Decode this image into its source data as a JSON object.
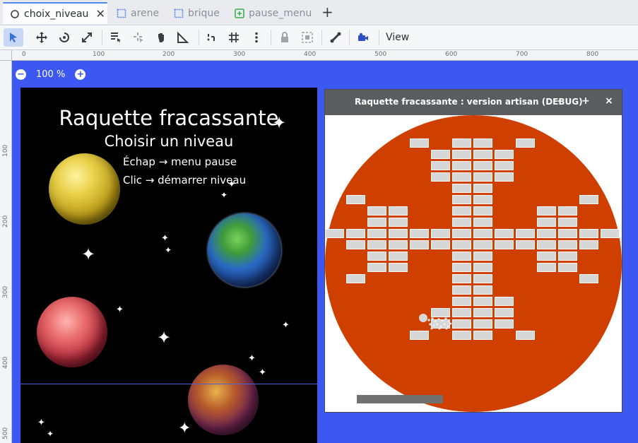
{
  "tabs": [
    {
      "label": "choix_niveau",
      "icon": "scene-node-icon",
      "active": true
    },
    {
      "label": "arene",
      "icon": "control-node-icon",
      "active": false
    },
    {
      "label": "brique",
      "icon": "control-node-icon",
      "active": false
    },
    {
      "label": "pause_menu",
      "icon": "container-node-icon",
      "active": false
    }
  ],
  "toolbar": {
    "view_label": "View",
    "tools": [
      "select-icon",
      "move-icon",
      "rotate-icon",
      "scale-icon",
      "list-select-icon",
      "pivot-icon",
      "pan-icon",
      "ruler-icon",
      "smart-snap-icon",
      "grid-snap-icon",
      "more-icon",
      "lock-icon",
      "group-icon",
      "bone-icon",
      "camera-icon"
    ]
  },
  "rulers": {
    "h_labels": [
      "0",
      "100",
      "200",
      "300",
      "400",
      "500",
      "600",
      "700",
      "800"
    ],
    "v_labels": [
      "100",
      "200",
      "300",
      "400",
      "500"
    ]
  },
  "zoom": {
    "level": "100 %"
  },
  "viewport": {
    "title": "Raquette fracassante",
    "subtitle": "Choisir un niveau",
    "hint1": "Échap → menu pause",
    "hint2": "Clic → démarrer niveau"
  },
  "debug_window": {
    "title": "Raquette fracassante : version artisan (DEBUG)",
    "min": "–",
    "max": "+",
    "close": "×"
  },
  "colors": {
    "canvas_bg": "#3d57f3",
    "arena": "#cf3f00",
    "brick": "#d7d7d7",
    "paddle": "#707070"
  }
}
